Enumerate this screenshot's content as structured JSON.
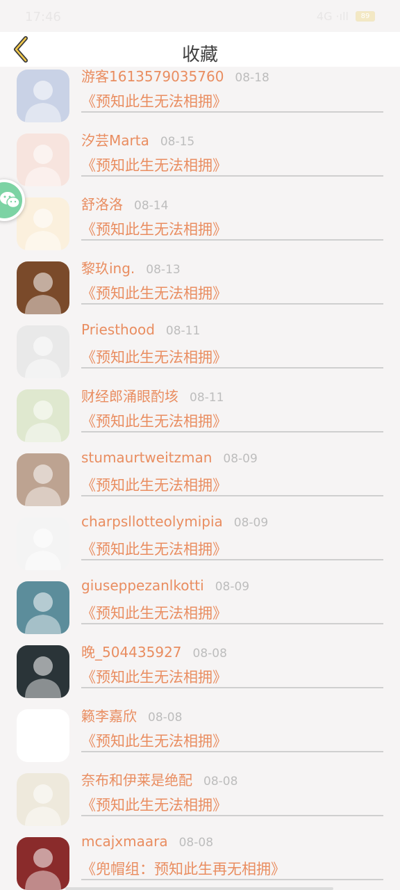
{
  "status_bar": {
    "time": "17:46",
    "signal": "4G ·ıll",
    "battery": "89"
  },
  "header": {
    "title": "收藏"
  },
  "favorites": [
    {
      "user": "游客1613579035760",
      "date": "08-18",
      "book": "《预知此生无法相拥》",
      "avatar_bg": "#c9d2e6"
    },
    {
      "user": "汐芸Marta",
      "date": "08-15",
      "book": "《预知此生无法相拥》",
      "avatar_bg": "#f7e4de"
    },
    {
      "user": "舒洛洛",
      "date": "08-14",
      "book": "《预知此生无法相拥》",
      "avatar_bg": "#fbf0dd"
    },
    {
      "user": "黎玖ing.",
      "date": "08-13",
      "book": "《预知此生无法相拥》",
      "avatar_bg": "#7a4a2a"
    },
    {
      "user": "Priesthood",
      "date": "08-11",
      "book": "《预知此生无法相拥》",
      "avatar_bg": "#e9e9e9"
    },
    {
      "user": "财经郎涌眼酌垓",
      "date": "08-11",
      "book": "《预知此生无法相拥》",
      "avatar_bg": "#dfe8cf"
    },
    {
      "user": "stumaurtweitzman",
      "date": "08-09",
      "book": "《预知此生无法相拥》",
      "avatar_bg": "#bda391"
    },
    {
      "user": "charpsllotteolymipia",
      "date": "08-09",
      "book": "《预知此生无法相拥》",
      "avatar_bg": "#f4f4f4"
    },
    {
      "user": "giuseppezanlkotti",
      "date": "08-09",
      "book": "《预知此生无法相拥》",
      "avatar_bg": "#5c8d9b"
    },
    {
      "user": "晚_504435927",
      "date": "08-08",
      "book": "《预知此生无法相拥》",
      "avatar_bg": "#2a3438"
    },
    {
      "user": "籁李嘉欣",
      "date": "08-08",
      "book": "《预知此生无法相拥》",
      "avatar_bg": "#ffffff"
    },
    {
      "user": "奈布和伊莱是绝配",
      "date": "08-08",
      "book": "《预知此生无法相拥》",
      "avatar_bg": "#eee9dc"
    },
    {
      "user": "mcajxmaara",
      "date": "08-08",
      "book": "《兜帽组：预知此生再无相拥》",
      "avatar_bg": "#8a2b2b"
    }
  ]
}
